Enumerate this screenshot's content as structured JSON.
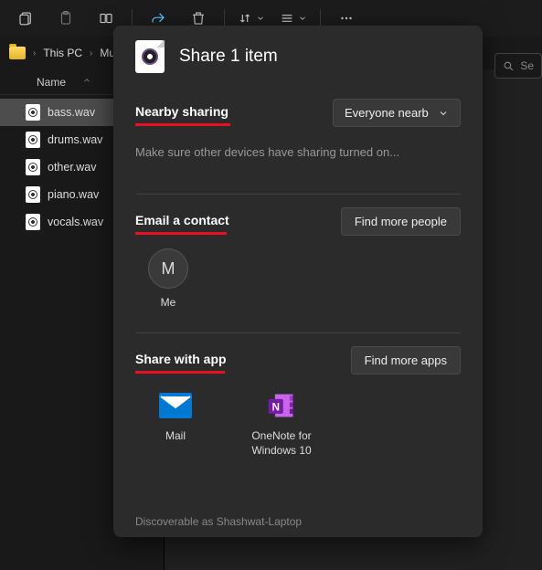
{
  "toolbar": {
    "icons": [
      "copy",
      "paste",
      "rename-box",
      "share",
      "delete",
      "sort",
      "view",
      "more"
    ]
  },
  "breadcrumb": {
    "items": [
      "This PC",
      "Music"
    ]
  },
  "search": {
    "placeholder": "Se"
  },
  "columns": {
    "name": "Name"
  },
  "files": [
    {
      "name": "bass.wav",
      "selected": true
    },
    {
      "name": "drums.wav",
      "selected": false
    },
    {
      "name": "other.wav",
      "selected": false
    },
    {
      "name": "piano.wav",
      "selected": false
    },
    {
      "name": "vocals.wav",
      "selected": false
    }
  ],
  "share": {
    "title": "Share 1 item",
    "nearby": {
      "heading": "Nearby sharing",
      "dropdown": "Everyone nearb",
      "hint": "Make sure other devices have sharing turned on..."
    },
    "email": {
      "heading": "Email a contact",
      "button": "Find more people",
      "contacts": [
        {
          "initial": "M",
          "label": "Me"
        }
      ]
    },
    "apps": {
      "heading": "Share with app",
      "button": "Find more apps",
      "list": [
        {
          "name": "Mail"
        },
        {
          "name": "OneNote for Windows 10"
        }
      ]
    },
    "footer": "Discoverable as Shashwat-Laptop"
  }
}
